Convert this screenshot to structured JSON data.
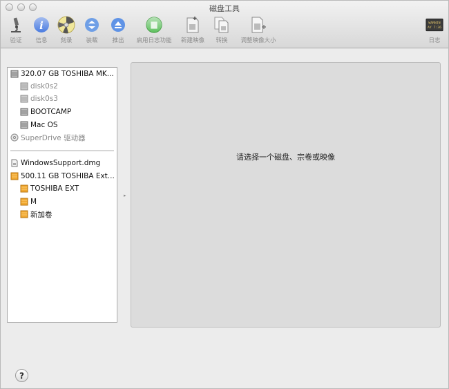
{
  "window": {
    "title": "磁盘工具"
  },
  "toolbar": {
    "items": [
      {
        "label": "验证",
        "icon": "microscope-icon"
      },
      {
        "label": "信息",
        "icon": "info-icon"
      },
      {
        "label": "刻录",
        "icon": "burn-disc-icon"
      },
      {
        "label": "装载",
        "icon": "mount-icon"
      },
      {
        "label": "推出",
        "icon": "eject-icon"
      },
      {
        "label": "启用日志功能",
        "icon": "journal-icon"
      },
      {
        "label": "新建映像",
        "icon": "new-image-icon"
      },
      {
        "label": "转换",
        "icon": "convert-icon"
      },
      {
        "label": "调整映像大小",
        "icon": "resize-image-icon"
      },
      {
        "label": "日志",
        "icon": "log-icon"
      }
    ],
    "log_icon_text": [
      "WARNIN",
      "AY 7:36"
    ]
  },
  "sidebar": {
    "items": [
      {
        "label": "320.07 GB TOSHIBA MK...",
        "kind": "internal-disk",
        "level": 0,
        "disabled": false
      },
      {
        "label": "disk0s2",
        "kind": "internal-disk",
        "level": 1,
        "disabled": true
      },
      {
        "label": "disk0s3",
        "kind": "internal-disk",
        "level": 1,
        "disabled": true
      },
      {
        "label": "BOOTCAMP",
        "kind": "internal-disk",
        "level": 1,
        "disabled": false
      },
      {
        "label": "Mac OS",
        "kind": "internal-disk",
        "level": 1,
        "disabled": false
      },
      {
        "label": "SuperDrive 驱动器",
        "kind": "optical-drive",
        "level": 0,
        "disabled": true
      },
      {
        "label": "WindowsSupport.dmg",
        "kind": "disk-image",
        "level": 0,
        "disabled": false
      },
      {
        "label": "500.11 GB TOSHIBA Ext...",
        "kind": "external-disk",
        "level": 0,
        "disabled": false
      },
      {
        "label": "TOSHIBA EXT",
        "kind": "external-disk",
        "level": 1,
        "disabled": false
      },
      {
        "label": "M",
        "kind": "external-disk",
        "level": 1,
        "disabled": false
      },
      {
        "label": "新加卷",
        "kind": "external-disk",
        "level": 1,
        "disabled": false
      }
    ]
  },
  "main": {
    "placeholder": "请选择一个磁盘、宗卷或映像"
  },
  "help": {
    "label": "?"
  },
  "colors": {
    "external_disk": "#f0a830",
    "info_blue": "#4a7be0",
    "eject_blue": "#5f93e6",
    "journal_green": "#5ec05e"
  }
}
